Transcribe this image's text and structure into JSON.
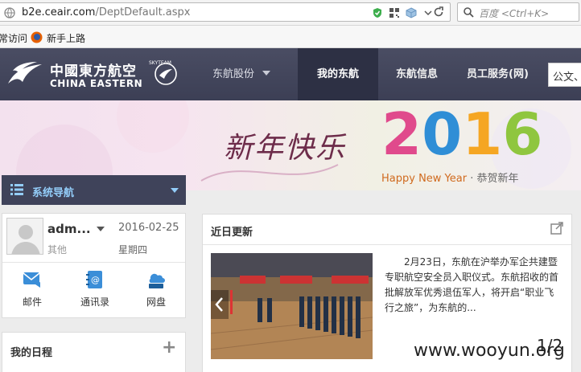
{
  "browser": {
    "url_host": "b2e.ceair.com",
    "url_path": "/DeptDefault.aspx",
    "search_placeholder": "百度 <Ctrl+K>",
    "bookmarks": [
      "常访问",
      "新手上路"
    ]
  },
  "site": {
    "logo_cn": "中國東方航空",
    "logo_en": "CHINA EASTERN",
    "nav": [
      "东航股份",
      "我的东航",
      "东航信息",
      "员工服务(网)"
    ],
    "search_value": "公文、",
    "accent": "#3f435a"
  },
  "banner": {
    "greeting": "新年快乐",
    "year": "2016",
    "english": "Happy New Year",
    "chinese": "恭贺新年"
  },
  "sidebar": {
    "nav_label": "系统导航",
    "user": {
      "name": "adm...",
      "dept": "其他",
      "date": "2016-02-25",
      "weekday": "星期四"
    },
    "quick_links": [
      "邮件",
      "通讯录",
      "网盘"
    ],
    "schedule_title": "我的日程"
  },
  "news": {
    "title": "近日更新",
    "body": "2月23日，东航在沪举办军企共建暨专职航空安全员入职仪式。东航招收的首批解放军优秀退伍军人，将开启“职业飞行之旅”，为东航的..."
  },
  "overlay": {
    "watermark": "www.wooyun.org",
    "pager": "1/2"
  }
}
